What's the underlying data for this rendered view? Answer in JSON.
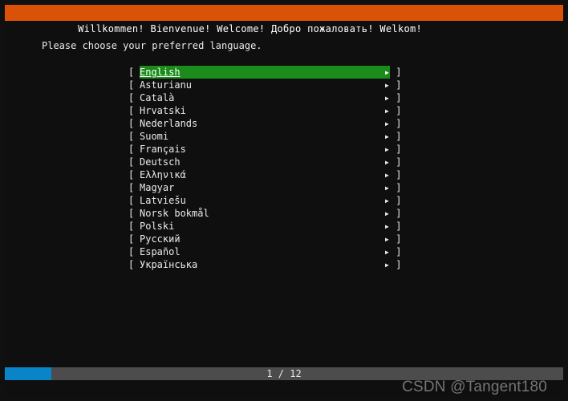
{
  "title": "Willkommen! Bienvenue! Welcome! Добро пожаловать! Welkom!",
  "prompt": "Please choose your preferred language.",
  "selected_index": 0,
  "languages": [
    "English",
    "Asturianu",
    "Català",
    "Hrvatski",
    "Nederlands",
    "Suomi",
    "Français",
    "Deutsch",
    "Ελληνικά",
    "Magyar",
    "Latviešu",
    "Norsk bokmål",
    "Polski",
    "Русский",
    "Español",
    "Українська"
  ],
  "glyphs": {
    "lbracket": "[ ",
    "rbracket": " ]",
    "chevron": "▸"
  },
  "pager": {
    "current": 1,
    "total": 12,
    "separator": " / "
  },
  "progress_fraction": 0.083,
  "watermark": "CSDN @Tangent180"
}
